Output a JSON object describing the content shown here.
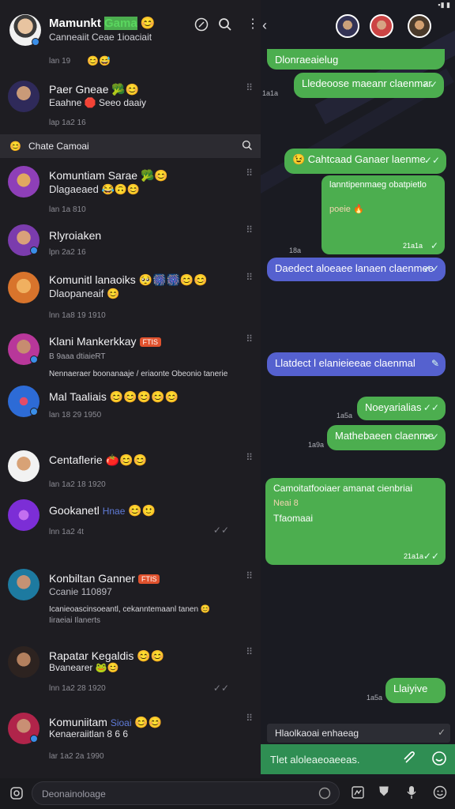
{
  "status": {
    "signal": "▪▮ ▮"
  },
  "header": {
    "title": "Mamunkt",
    "title_tag": "Gama",
    "title_emoji": "😊",
    "subtitle": "Canneaiit  Ceae 1ioaciait"
  },
  "chats": [
    {
      "name": "",
      "preview": "",
      "time": "lan  19",
      "emoji": "😊😅"
    },
    {
      "name": "Paer Gneae",
      "emoji": "🥦😊",
      "preview": "Eaahne 🛑 Seeo daaiy",
      "time": "lap  1a2 16"
    },
    {
      "name": "Komuntiam Sarae",
      "emoji": "🥦😊",
      "preview": "Dlagaeaed",
      "preview_emoji": "😂🙃😊",
      "time": "lan  1a 810"
    },
    {
      "name": "Rlyroiaken",
      "emoji": "",
      "preview": "",
      "time": "lpn  2a2 16"
    },
    {
      "name": "Komunitl lanaoiks",
      "emoji": "🥺🎆🎆😊😊",
      "preview": "Dlaopaneaif",
      "preview_emoji": "😊",
      "time": "lnn  1a8  19  1910"
    },
    {
      "name": "Klani Mankerkkay",
      "badge": "FTIS",
      "emoji": "",
      "preview": "B  9aaa dtiaieRT",
      "time": ""
    },
    {
      "name": "Mal Taaliais",
      "emoji": "😊😊😊😊😊",
      "preview": "Nennaeraer  boonanaaje  / eriaonte Obeonio  tanerie",
      "time": "lan  18  29  1950"
    },
    {
      "name": "Centaflerie",
      "emoji": "🍅😊😊",
      "preview": "",
      "time": "lan  1a2  18  1920"
    },
    {
      "name": "Gookanetl",
      "tag": "Hnae",
      "emoji": "😊🙂",
      "preview": "",
      "time": "lnn  1a2  4t"
    },
    {
      "name": "Konbiltan Ganner",
      "badge": "FTIS",
      "emoji": "",
      "preview": "Ccanie 110897",
      "preview2": "Icanieoascinsoeantl, cekanntemaanl tanen 😊",
      "preview3": "Iiraeiai  Ilanerts",
      "time": ""
    },
    {
      "name": "Rapatar Kegaldis",
      "emoji": "😊😊",
      "preview": "Bvanearer",
      "preview_emoji": "🐸😊",
      "time": "lnn  1a2  28  1920"
    },
    {
      "name": "Komuniitam",
      "tag": "Sioai",
      "emoji": "😊😊",
      "preview": "Kenaeraiitlan 8  6  6",
      "time": "lar  1a2  2a  1990"
    }
  ],
  "section": {
    "label": "Chate Camoai"
  },
  "messages": [
    {
      "text": "Dlonraeaielug",
      "time": ""
    },
    {
      "text": "Lledeoose maeanr claenmar",
      "time": "1a1a"
    },
    {
      "text": "😉 Cahtcaad Ganaer laenme",
      "time": ""
    },
    {
      "text": "lanntipenmaeg obatpietlo",
      "text2": "poeie",
      "time": "21a1a",
      "emoji": "🔥"
    },
    {
      "text": "Daedect aloeaee lanaen claenmee",
      "time": "18a"
    },
    {
      "text": "Llatdect l elanieieeae claenmal",
      "time": ""
    },
    {
      "text": "Noeyarialias",
      "time": "1a5a"
    },
    {
      "text": "Mathebaeen claenme",
      "time": "1a9a"
    },
    {
      "text": "Camoitatfooiaer amanat cienbriai",
      "text2": "Neai 8",
      "text3": "Tfaomaai",
      "time": "21a1a"
    },
    {
      "text": "Llaiyive",
      "time": "1a5a"
    }
  ],
  "reply": {
    "quote": "Hlaolkaoai enhaeag",
    "draft": "Tlet  aloleaeoaeeas."
  },
  "input": {
    "placeholder": "Deonainoloage"
  }
}
